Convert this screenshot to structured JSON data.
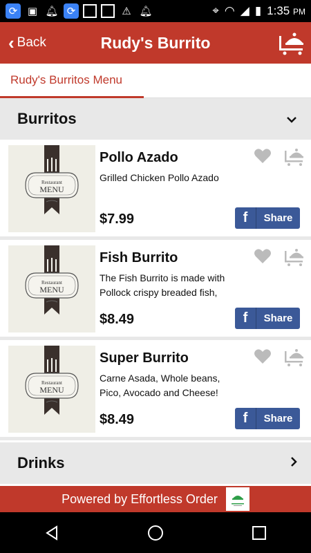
{
  "status_bar": {
    "time": "1:35",
    "ampm": "PM",
    "icons": [
      "sync-icon",
      "image-icon",
      "notification-bell-icon",
      "sync-icon",
      "blank-square-icon",
      "blank-square-icon",
      "warning-icon",
      "notification-bell-icon",
      "location-icon",
      "wifi-icon",
      "signal-icon",
      "battery-icon"
    ]
  },
  "header": {
    "back_label": "Back",
    "title": "Rudy's Burrito"
  },
  "tabs": [
    {
      "label": "Rudy's Burritos Menu",
      "active": true
    }
  ],
  "sections": [
    {
      "title": "Burritos",
      "expanded": true
    },
    {
      "title": "Drinks",
      "expanded": false
    }
  ],
  "items": [
    {
      "name": "Pollo Azado",
      "description": "Grilled Chicken Pollo Azado",
      "price": "$7.99",
      "share_label": "Share",
      "menu_card_line1": "Restaurant",
      "menu_card_line2": "MENU"
    },
    {
      "name": "Fish Burrito",
      "description": "The Fish Burrito is made with Pollock crispy breaded fish, Rice, cheese, and our delish",
      "price": "$8.49",
      "share_label": "Share",
      "menu_card_line1": "Restaurant",
      "menu_card_line2": "MENU"
    },
    {
      "name": "Super Burrito",
      "description": "Carne Asada, Whole beans, Pico, Avocado and Cheese!",
      "price": "$8.49",
      "share_label": "Share",
      "menu_card_line1": "Restaurant",
      "menu_card_line2": "MENU"
    }
  ],
  "footer": {
    "powered_text": "Powered by Effortless Order"
  },
  "colors": {
    "brand_red": "#c0392b",
    "facebook_blue": "#3b5998",
    "section_gray": "#e8e8e8"
  }
}
